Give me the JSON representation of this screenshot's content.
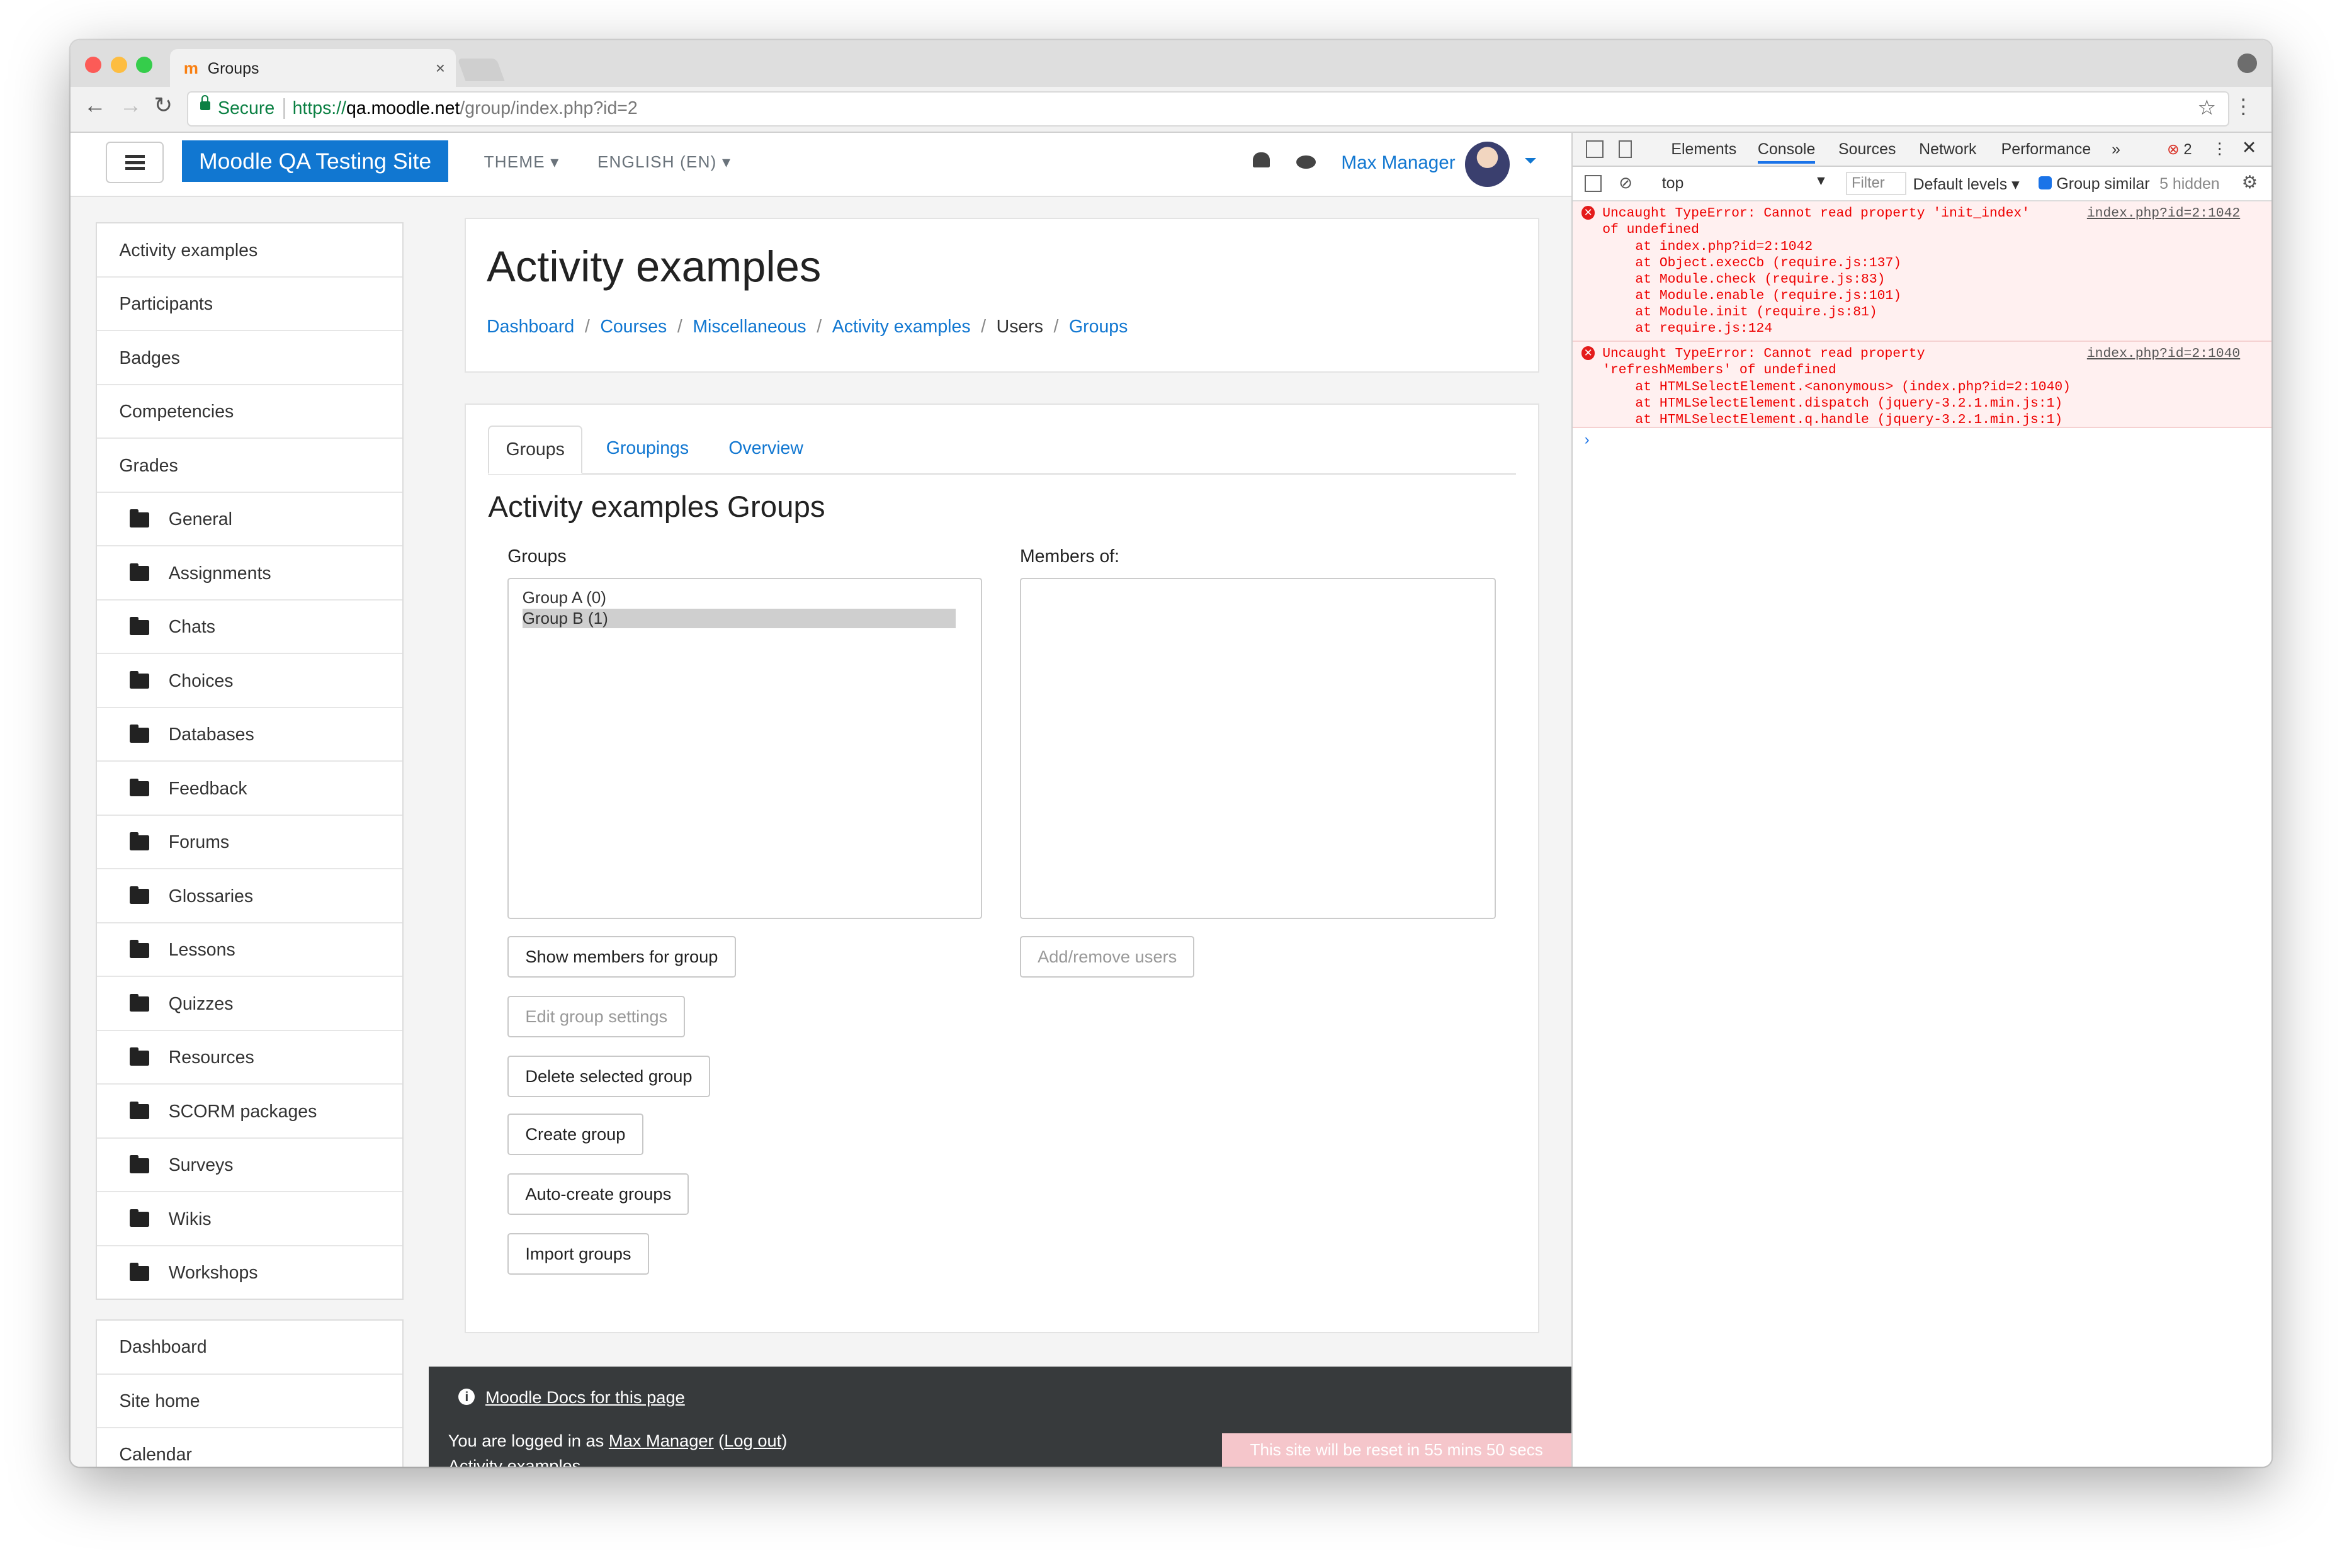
{
  "browser": {
    "tab_title": "Groups",
    "favicon": "m",
    "secure_label": "Secure",
    "url_scheme": "https://",
    "url_host": "qa.moodle.net",
    "url_path": "/group/index.php?id=2"
  },
  "navbar": {
    "brand": "Moodle QA Testing Site",
    "theme": "THEME",
    "language": "ENGLISH (EN)",
    "user": "Max Manager"
  },
  "sidebar": {
    "items": [
      "Activity examples",
      "Participants",
      "Badges",
      "Competencies",
      "Grades"
    ],
    "sections": [
      "General",
      "Assignments",
      "Chats",
      "Choices",
      "Databases",
      "Feedback",
      "Forums",
      "Glossaries",
      "Lessons",
      "Quizzes",
      "Resources",
      "SCORM packages",
      "Surveys",
      "Wikis",
      "Workshops"
    ],
    "bottom": [
      "Dashboard",
      "Site home",
      "Calendar"
    ]
  },
  "header": {
    "title": "Activity examples",
    "breadcrumbs": [
      "Dashboard",
      "Courses",
      "Miscellaneous",
      "Activity examples",
      "Users",
      "Groups"
    ]
  },
  "main": {
    "tabs": [
      "Groups",
      "Groupings",
      "Overview"
    ],
    "heading": "Activity examples Groups",
    "groups_label": "Groups",
    "members_label": "Members of:",
    "groups": [
      "Group A (0)",
      "Group B (1)"
    ],
    "buttons": {
      "show_members": "Show members for group",
      "edit_settings": "Edit group settings",
      "delete": "Delete selected group",
      "create": "Create group",
      "auto_create": "Auto-create groups",
      "import": "Import groups",
      "add_remove": "Add/remove users"
    }
  },
  "footer": {
    "docs_link": "Moodle Docs for this page",
    "logged_prefix": "You are logged in as",
    "user": "Max Manager",
    "logout": "Log out",
    "course": "Activity examples",
    "reset_notice": "This site will be reset in 55 mins 50 secs"
  },
  "devtools": {
    "tabs": [
      "Elements",
      "Console",
      "Sources",
      "Network",
      "Performance"
    ],
    "more": "»",
    "error_count": "2",
    "context": "top",
    "filter_placeholder": "Filter",
    "levels": "Default levels",
    "group_similar": "Group similar",
    "hidden": "5 hidden",
    "errors": [
      {
        "message": "Uncaught TypeError: Cannot read property 'init_index'",
        "message2": "of undefined",
        "source": "index.php?id=2:1042",
        "stack": [
          "at index.php?id=2:1042",
          "at Object.execCb (require.js:137)",
          "at Module.check (require.js:83)",
          "at Module.enable (require.js:101)",
          "at Module.init (require.js:81)",
          "at require.js:124"
        ]
      },
      {
        "message": "Uncaught TypeError: Cannot read property",
        "message2": "'refreshMembers' of undefined",
        "source": "index.php?id=2:1040",
        "stack": [
          "at HTMLSelectElement.<anonymous> (index.php?id=2:1040)",
          "at HTMLSelectElement.dispatch (jquery-3.2.1.min.js:1)",
          "at HTMLSelectElement.q.handle (jquery-3.2.1.min.js:1)"
        ]
      }
    ]
  },
  "colors": {
    "brand": "#1177d1",
    "link": "#1177d1",
    "footer_bg": "#373a3c",
    "error": "#e00000"
  }
}
